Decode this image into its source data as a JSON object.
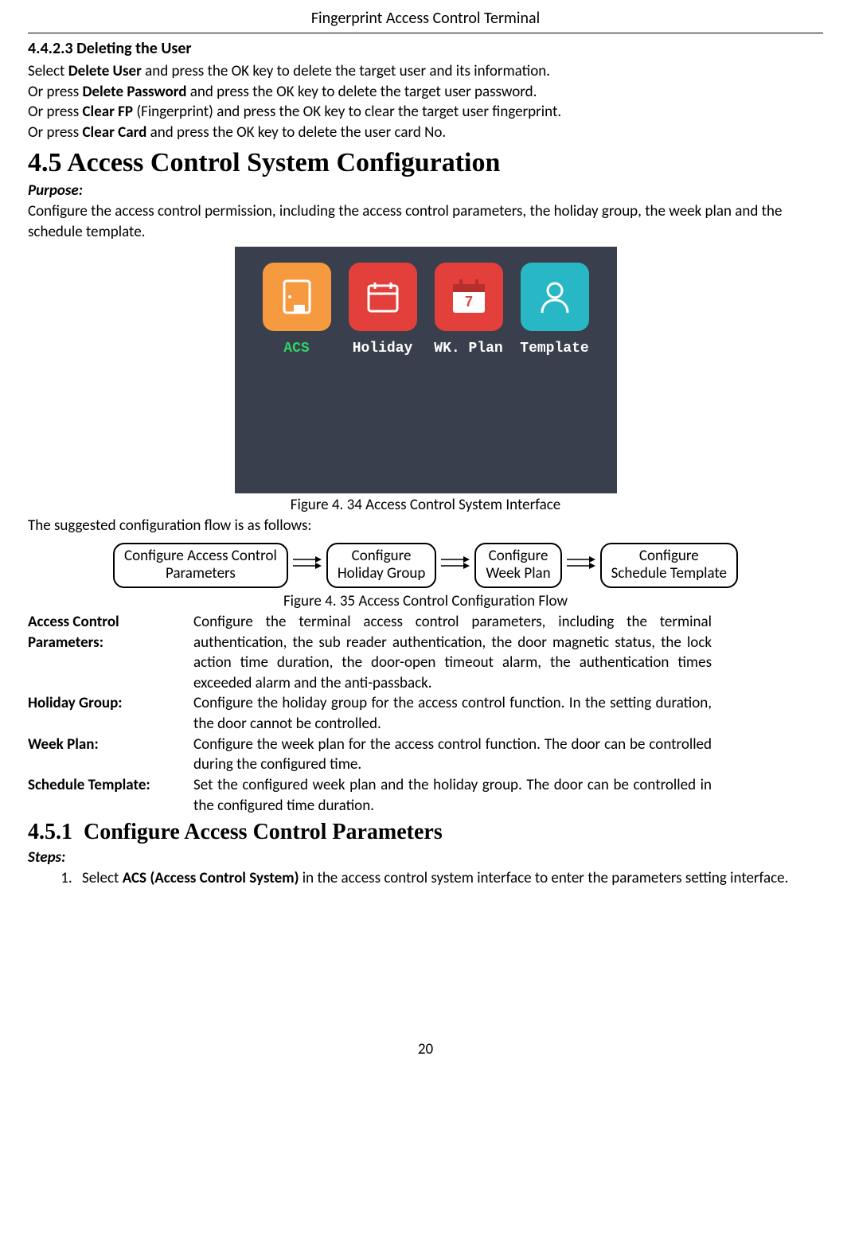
{
  "header": "Fingerprint Access Control Terminal",
  "section_44x": {
    "num": "4.4.2.3",
    "title": "Deleting the User",
    "p1a": "Select ",
    "p1b": "Delete User",
    "p1c": " and press the OK key to delete the target user and its information.",
    "p2a": "Or press ",
    "p2b": "Delete Password",
    "p2c": " and press the OK key to delete the target user password.",
    "p3a": "Or press ",
    "p3b": "Clear FP",
    "p3c": " (Fingerprint) and press the OK key to clear the target user fingerprint.",
    "p4a": "Or press ",
    "p4b": "Clear Card",
    "p4c": " and press the OK key to delete the user card No."
  },
  "section_45": {
    "num": "4.5",
    "title": "Access Control System Configuration",
    "purpose_label": "Purpose:",
    "purpose_text": "Configure the access control permission, including the access control parameters, the holiday group, the week plan and the schedule template."
  },
  "interface": {
    "tiles": [
      {
        "label": "ACS",
        "active": true,
        "color": "orange"
      },
      {
        "label": "Holiday",
        "active": false,
        "color": "red"
      },
      {
        "label": "WK. Plan",
        "active": false,
        "color": "red2"
      },
      {
        "label": "Template",
        "active": false,
        "color": "teal"
      }
    ]
  },
  "figure1": "Figure 4. 34 Access Control System Interface",
  "flow_intro": "The suggested configuration flow is as follows:",
  "flow": [
    "Configure Access Control\nParameters",
    "Configure\nHoliday Group",
    "Configure\nWeek Plan",
    "Configure\nSchedule Template"
  ],
  "figure2": "Figure 4. 35 Access Control Configuration Flow",
  "defs": [
    {
      "term": "Access Control Parameters:",
      "desc": "Configure the terminal access control parameters, including the terminal authentication, the sub reader authentication, the door magnetic status, the lock action time duration, the door-open timeout alarm, the authentication times exceeded alarm and the anti-passback."
    },
    {
      "term": "Holiday Group:",
      "desc": "Configure the holiday group for the access control function. In the setting duration, the door cannot be controlled."
    },
    {
      "term": "Week Plan:",
      "desc": "Configure the week plan for the access control function. The door can be controlled during the configured time."
    },
    {
      "term": "Schedule Template:",
      "desc": "Set the configured week plan and the holiday group. The door can be controlled in the configured time duration."
    }
  ],
  "section_451": {
    "num": "4.5.1",
    "title": "Configure Access Control Parameters",
    "steps_label": "Steps:",
    "step1a": "Select ",
    "step1b": "ACS (Access Control System)",
    "step1c": " in the access control system interface to enter the parameters setting interface."
  },
  "page_number": "20"
}
